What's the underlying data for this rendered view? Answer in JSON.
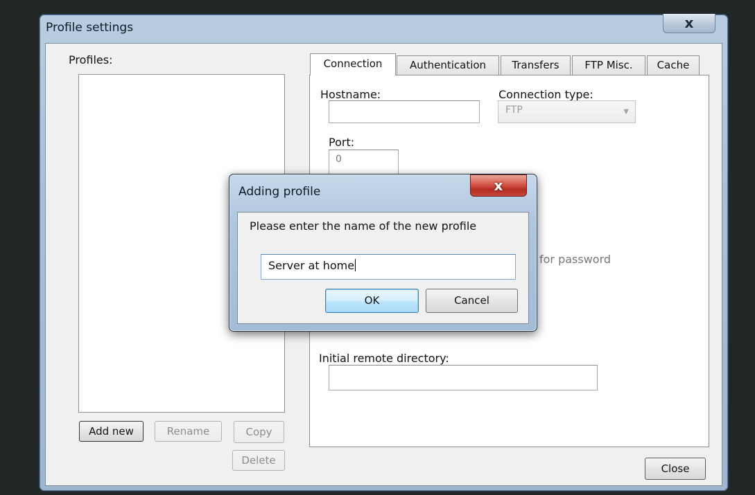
{
  "main_window": {
    "title": "Profile settings",
    "close_glyph": "x",
    "profiles_label": "Profiles:",
    "buttons": {
      "add_new": "Add new",
      "rename": "Rename",
      "copy": "Copy",
      "delete": "Delete",
      "close": "Close"
    },
    "tabs": [
      {
        "label": "Connection",
        "active": true
      },
      {
        "label": "Authentication",
        "active": false
      },
      {
        "label": "Transfers",
        "active": false
      },
      {
        "label": "FTP Misc.",
        "active": false
      },
      {
        "label": "Cache",
        "active": false
      }
    ],
    "connection_tab": {
      "hostname_label": "Hostname:",
      "hostname_value": "",
      "connection_type_label": "Connection type:",
      "connection_type_value": "FTP",
      "port_label": "Port:",
      "port_value": "0",
      "password_fragment": "for password",
      "initial_remote_dir_label": "Initial remote directory:",
      "initial_remote_dir_value": ""
    }
  },
  "dialog": {
    "title": "Adding profile",
    "close_glyph": "x",
    "prompt": "Please enter the name of the new profile",
    "input_value": "Server at home",
    "ok_label": "OK",
    "cancel_label": "Cancel"
  },
  "colors": {
    "desktop": "#202726",
    "frame": "#a9bfd6",
    "dialog_close": "#c9493c",
    "default_button": "#bee6fd"
  }
}
